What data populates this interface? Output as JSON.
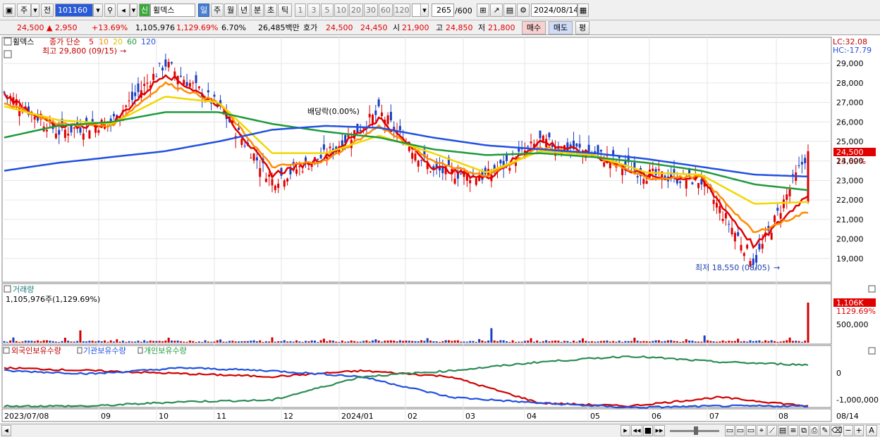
{
  "toolbar": {
    "market": "주",
    "all": "전",
    "code": "101160",
    "new_badge": "신",
    "name": "휠덱스",
    "periods": [
      "일",
      "주",
      "월",
      "년",
      "분",
      "초",
      "틱"
    ],
    "selected_period": "일",
    "intervals": [
      "1",
      "3",
      "5",
      "10",
      "20",
      "30",
      "60",
      "120"
    ],
    "count": "265",
    "count_total": "/600",
    "date": "2024/08/14"
  },
  "quote": {
    "price": "24,500",
    "change": "▲ 2,950",
    "change_pct": "+13.69%",
    "volume": "1,105,976",
    "volume_pct": "1,129.69%",
    "turnover": "6.70%",
    "amount": "26,485백만",
    "hoga_label": "호가",
    "ask": "24,500",
    "bid": "24,450",
    "open_label": "시",
    "open": "21,900",
    "high_label": "고",
    "high": "24,850",
    "low_label": "저",
    "low": "21,800",
    "buy": "매수",
    "sell": "매도",
    "eval": "평"
  },
  "price_panel": {
    "stock_tag": "휠덱스",
    "ma_legend": "종가 단순",
    "ma_periods": [
      "5",
      "10",
      "20",
      "60",
      "120"
    ],
    "ma_colors": [
      "#e00000",
      "#ff8c00",
      "#f0d800",
      "#1e9a3c",
      "#2050e0"
    ],
    "lc": "LC:32.08",
    "hc": "HC:-17.79",
    "max_note": "최고 29,800 (09/15)",
    "min_note": "최저 18,550 (08/05)",
    "dividend_note": "배당락(0.00%)",
    "last_price": "24,500",
    "last_change": "13.69%",
    "y_ticks": [
      "29,000",
      "28,000",
      "27,000",
      "26,000",
      "25,000",
      "24,000",
      "23,000",
      "22,000",
      "21,000",
      "20,000",
      "19,000"
    ]
  },
  "volume_panel": {
    "title": "거래량",
    "value": "1,105,976주(1,129.69%)",
    "last_label": "1,106K",
    "last_pct": "1129.69%",
    "y_tick": "500,000"
  },
  "holding_panel": {
    "series_names": [
      "외국인보유수량",
      "기관보유수량",
      "개인보유수량"
    ],
    "y_ticks": [
      "0",
      "-1,000,000"
    ]
  },
  "x_axis": {
    "labels": [
      "2023/07/08",
      "09",
      "10",
      "11",
      "12",
      "2024/01",
      "02",
      "03",
      "04",
      "05",
      "06",
      "07",
      "08",
      "08/14"
    ]
  },
  "chart_data": [
    {
      "type": "candlestick",
      "title": "휠덱스",
      "ylabel": "",
      "ylim": [
        18000,
        29800
      ],
      "x": [
        "2023/07",
        "2023/08",
        "2023/09",
        "2023/09/15",
        "2023/10",
        "2023/11",
        "2023/12",
        "2024/01",
        "2024/02",
        "2024/03",
        "2024/04",
        "2024/05",
        "2024/06",
        "2024/07",
        "2024/08/05",
        "2024/08/14"
      ],
      "series": [
        {
          "name": "close",
          "values": [
            27500,
            25500,
            26000,
            29000,
            26800,
            23000,
            24300,
            26500,
            23500,
            23200,
            25000,
            24400,
            23300,
            23000,
            18800,
            24500
          ]
        },
        {
          "name": "5",
          "values": [
            27400,
            25700,
            25900,
            28500,
            26900,
            23300,
            24200,
            26200,
            23700,
            23100,
            25000,
            24300,
            23200,
            23100,
            19600,
            22300
          ]
        },
        {
          "name": "10",
          "values": [
            27000,
            25900,
            25800,
            28000,
            27000,
            23700,
            24000,
            25800,
            24000,
            23200,
            24700,
            24300,
            23100,
            23200,
            20300,
            21400
          ]
        },
        {
          "name": "20",
          "values": [
            26800,
            26100,
            25900,
            27300,
            27000,
            24400,
            24400,
            25300,
            24400,
            23400,
            24500,
            24300,
            23400,
            23300,
            21800,
            21900
          ]
        },
        {
          "name": "60",
          "values": [
            25200,
            25800,
            26000,
            26500,
            26500,
            25900,
            25500,
            25200,
            24600,
            24300,
            24400,
            24200,
            23900,
            23500,
            22800,
            22500
          ]
        },
        {
          "name": "120",
          "values": [
            23500,
            23900,
            24200,
            24500,
            25000,
            25600,
            25800,
            25700,
            25200,
            24800,
            24600,
            24400,
            24100,
            23700,
            23300,
            23200
          ]
        }
      ],
      "annotations": [
        {
          "text": "최고 29,800 (09/15)",
          "x": "2023/09/15",
          "y": 29800
        },
        {
          "text": "최저 18,550 (08/05)",
          "x": "2024/08/05",
          "y": 18550
        },
        {
          "text": "배당락(0.00%)",
          "x": "2023/12"
        }
      ]
    },
    {
      "type": "bar",
      "title": "거래량",
      "ylim": [
        0,
        1106000
      ],
      "x": [
        "2023/09/15",
        "2024/03",
        "2024/08/05",
        "2024/08/14"
      ],
      "values": [
        340000,
        400000,
        200000,
        1105976
      ]
    },
    {
      "type": "line",
      "title": "",
      "ylim": [
        -1000000,
        700000
      ],
      "x": [
        "2023/07",
        "2023/09",
        "2023/11",
        "2024/01",
        "2024/03",
        "2024/04",
        "2024/05",
        "2024/06",
        "2024/07",
        "2024/08/14"
      ],
      "series": [
        {
          "name": "외국인보유수량",
          "values": [
            300000,
            200000,
            100000,
            0,
            200000,
            0,
            -900000,
            -1000000,
            -700000,
            -1000000
          ]
        },
        {
          "name": "기관보유수량",
          "values": [
            200000,
            100000,
            300000,
            200000,
            0,
            -700000,
            -900000,
            -1050000,
            -1000000,
            -1000000
          ]
        },
        {
          "name": "개인보유수량",
          "values": [
            -1000000,
            -1000000,
            -850000,
            -800000,
            0,
            200000,
            500000,
            700000,
            500000,
            400000
          ]
        }
      ]
    }
  ]
}
